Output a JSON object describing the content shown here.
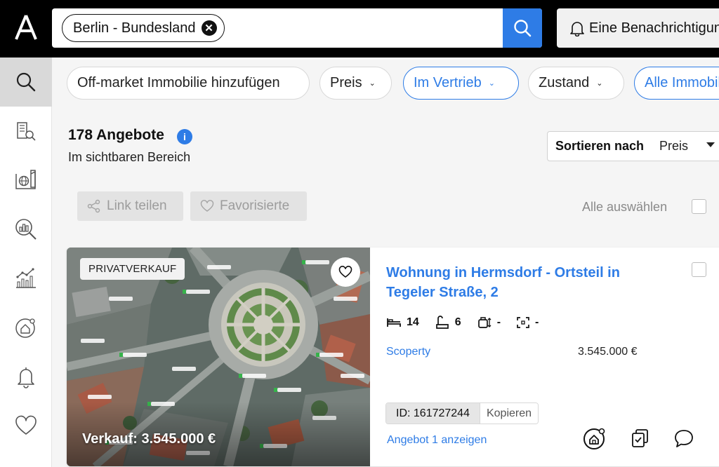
{
  "header": {
    "search_chip": "Berlin - Bundesland",
    "notification_button": "Eine Benachrichtigung"
  },
  "sidebar": {
    "items": [
      {
        "icon": "search-icon",
        "active": true
      },
      {
        "icon": "building-search-icon",
        "active": false
      },
      {
        "icon": "globe-map-icon",
        "active": false
      },
      {
        "icon": "analytics-search-icon",
        "active": false
      },
      {
        "icon": "trend-chart-icon",
        "active": false
      },
      {
        "icon": "home-value-icon",
        "active": false
      },
      {
        "icon": "bell-icon",
        "active": false
      },
      {
        "icon": "heart-icon",
        "active": false
      }
    ]
  },
  "filters": {
    "off_market": "Off-market Immobilie hinzufügen",
    "price": "Preis",
    "status": "Im Vertrieb",
    "condition": "Zustand",
    "all_property": "Alle Immobilien"
  },
  "results": {
    "count": "178 Angebote",
    "scope": "Im sichtbaren Bereich",
    "sort_label": "Sortieren nach",
    "sort_value": "Preis",
    "share_link": "Link teilen",
    "favorites": "Favorisierte",
    "select_all": "Alle auswählen"
  },
  "listing": {
    "badge": "PRIVATVERKAUF",
    "image_price": "Verkauf: 3.545.000 €",
    "title": "Wohnung in Hermsdorf - Ortsteil in Tegeler Straße, 2",
    "features": {
      "beds": "14",
      "baths": "6",
      "rooms": "-",
      "area": "-"
    },
    "source": "Scoperty",
    "price": "3.545.000 €",
    "id_label": "ID: 161727244",
    "copy_label": "Kopieren",
    "offer_link": "Angebot 1 anzeigen"
  },
  "colors": {
    "accent": "#2e7ce6",
    "topbar": "#000000",
    "background": "#f5f5f5"
  }
}
